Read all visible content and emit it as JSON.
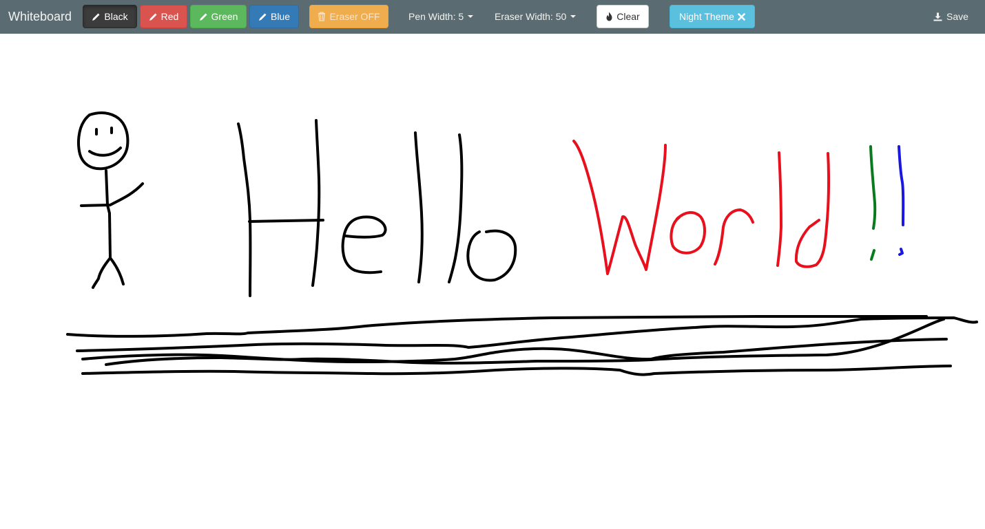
{
  "app": {
    "brand": "Whiteboard"
  },
  "toolbar": {
    "black_label": "Black",
    "red_label": "Red",
    "green_label": "Green",
    "blue_label": "Blue",
    "eraser_label": "Eraser OFF",
    "pen_width_label": "Pen Width: 5",
    "eraser_width_label": "Eraser Width: 50",
    "clear_label": "Clear",
    "night_theme_label": "Night Theme",
    "save_label": "Save"
  },
  "icons": {
    "pen": "pencil-icon",
    "eraser": "trash-icon",
    "clear": "fire-icon",
    "night": "close-icon",
    "save": "download-icon"
  },
  "colors": {
    "navbar": "#5a6c71",
    "ink_black": "#000000",
    "ink_red": "#e8101c",
    "ink_green": "#0a7a1e",
    "ink_blue": "#1818e0"
  }
}
